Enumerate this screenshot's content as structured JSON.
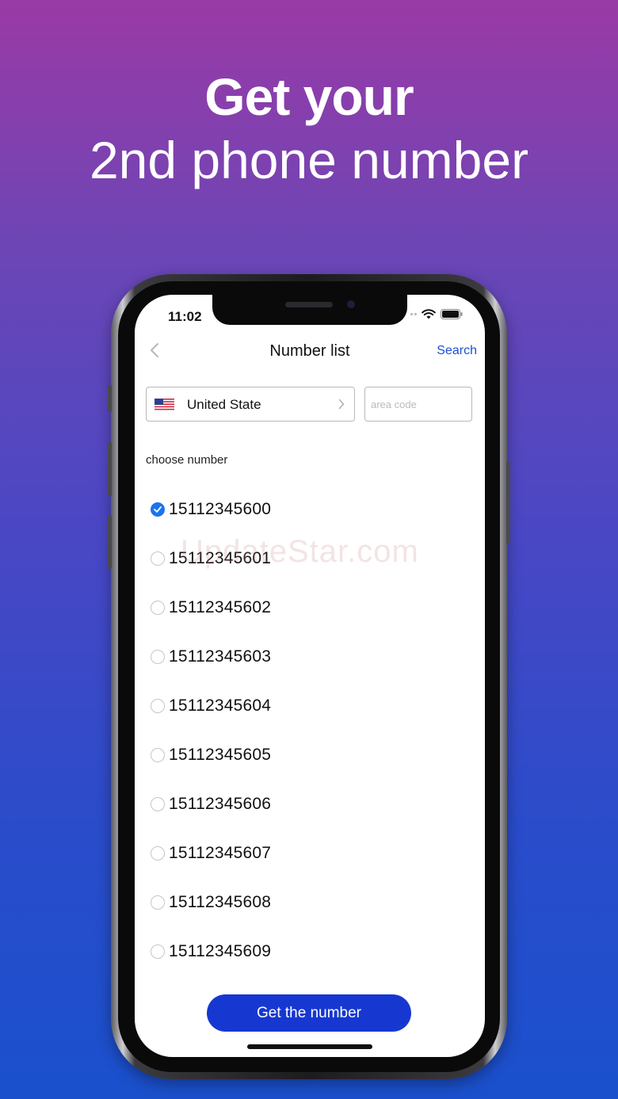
{
  "promo": {
    "headline_bold": "Get your",
    "headline_light": "2nd phone number"
  },
  "status_bar": {
    "time": "11:02",
    "icons": [
      "wifi-icon",
      "battery-icon"
    ]
  },
  "nav": {
    "back_icon": "chevron-left-icon",
    "title": "Number list",
    "search_label": "Search"
  },
  "country_selector": {
    "flag_icon": "us-flag-icon",
    "label": "United State",
    "chevron_icon": "chevron-right-icon"
  },
  "area_code": {
    "placeholder": "area code",
    "value": ""
  },
  "section_label": "choose number",
  "numbers": [
    {
      "value": "15112345600",
      "selected": true
    },
    {
      "value": "15112345601",
      "selected": false
    },
    {
      "value": "15112345602",
      "selected": false
    },
    {
      "value": "15112345603",
      "selected": false
    },
    {
      "value": "15112345604",
      "selected": false
    },
    {
      "value": "15112345605",
      "selected": false
    },
    {
      "value": "15112345606",
      "selected": false
    },
    {
      "value": "15112345607",
      "selected": false
    },
    {
      "value": "15112345608",
      "selected": false
    },
    {
      "value": "15112345609",
      "selected": false
    }
  ],
  "get_button_label": "Get the number",
  "watermark": "UpdateStar.com",
  "colors": {
    "accent": "#1a73f0",
    "button": "#1638d1",
    "link": "#1a4fd6",
    "background_top": "#9a3aa6",
    "background_bottom": "#1a50cc"
  }
}
